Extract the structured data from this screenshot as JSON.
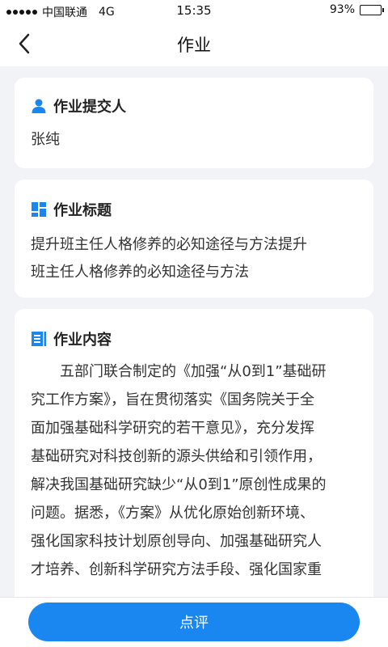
{
  "status_bar": {
    "carrier": "中国联通",
    "network": "4G",
    "time": "15:35",
    "battery": "93%",
    "battery_level": 0.93
  },
  "nav": {
    "title": "作业"
  },
  "submitter": {
    "label": "作业提交人",
    "value": "张纯",
    "icon": "person-icon"
  },
  "homework_title": {
    "label": "作业标题",
    "lines": [
      "提升班主任人格修养的必知途径与方法提升",
      "班主任人格修养的必知途径与方法"
    ],
    "icon": "grid-icon"
  },
  "homework_content": {
    "label": "作业内容",
    "icon": "document-icon",
    "lines": [
      "　　五部门联合制定的《加强“从0到1”基础研",
      "究工作方案》，旨在贯彻落实《国务院关于全",
      "面加强基础科学研究的若干意见》，充分发挥",
      "基础研究对科技创新的源头供给和引领作用，",
      "解决我国基础研究缺少“从0到1”原创性成果的",
      "问题。据悉，《方案》从优化原始创新环境、",
      "强化国家科技计划原创导向、加强基础研究人",
      "才培养、创新科学研究方法手段、强化国家重"
    ]
  },
  "actions": {
    "comment_label": "点评"
  },
  "colors": {
    "accent": "#1a86f0",
    "background": "#f2f3f7"
  }
}
